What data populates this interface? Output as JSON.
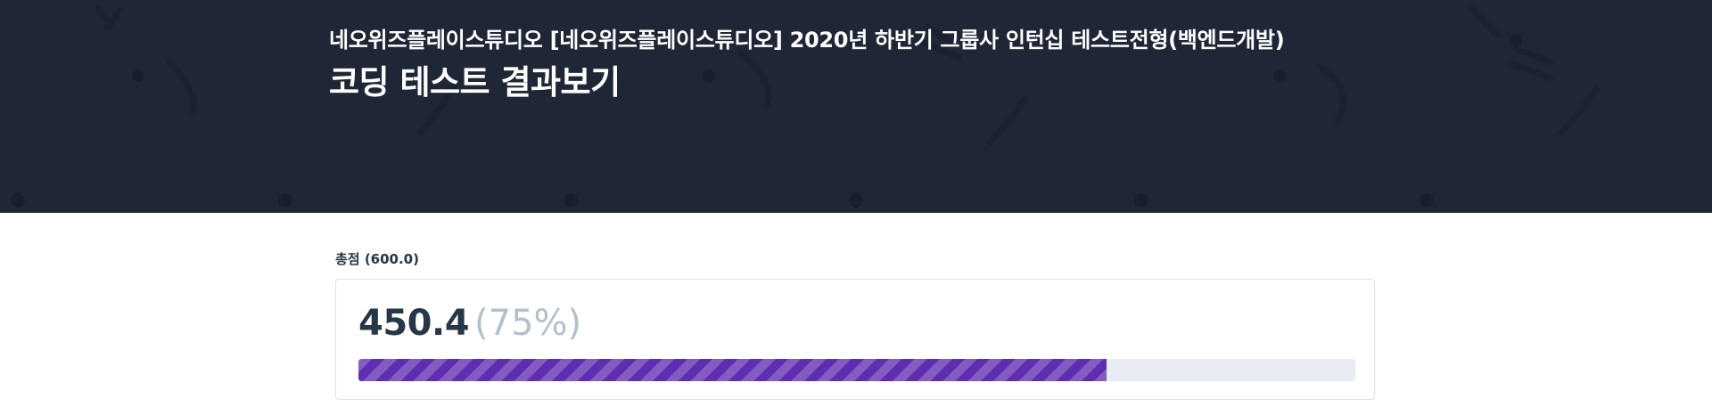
{
  "header": {
    "test_name": "네오위즈플레이스튜디오 [네오위즈플레이스튜디오] 2020년 하반기 그룹사 인턴십 테스트전형(백엔드개발)",
    "page_title": "코딩 테스트 결과보기",
    "background_color": "#1f2737"
  },
  "score": {
    "total_label": "총점 (600.0)",
    "value": "450.4",
    "percent_text": "(75%)",
    "progress_fraction": 0.75,
    "bar_color": "#5f2eb0"
  }
}
